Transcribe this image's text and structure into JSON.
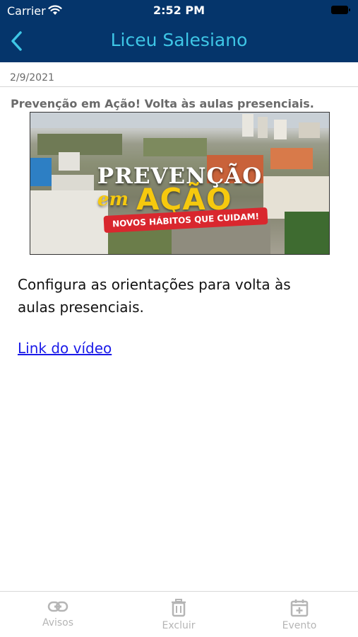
{
  "status_bar": {
    "carrier": "Carrier",
    "time": "2:52 PM"
  },
  "nav": {
    "title": "Liceu Salesiano",
    "back_icon": "chevron-left-icon",
    "title_color": "#3ec6e6",
    "bar_color": "#05356b"
  },
  "post": {
    "date": "2/9/2021",
    "title": "Prevenção em Ação! Volta às aulas presenciais.",
    "banner": {
      "line1": "PREVENÇÃO",
      "line2_script": "em",
      "line2": "AÇÃO",
      "ribbon": "NOVOS HÁBITOS QUE CUIDAM!"
    },
    "body": "Configura as orientações para volta às aulas presenciais.",
    "link_label": "Link do vídeo"
  },
  "tabs": [
    {
      "label": "Avisos",
      "icon": "link-icon"
    },
    {
      "label": "Excluir",
      "icon": "trash-icon"
    },
    {
      "label": "Evento",
      "icon": "calendar-add-icon"
    }
  ]
}
